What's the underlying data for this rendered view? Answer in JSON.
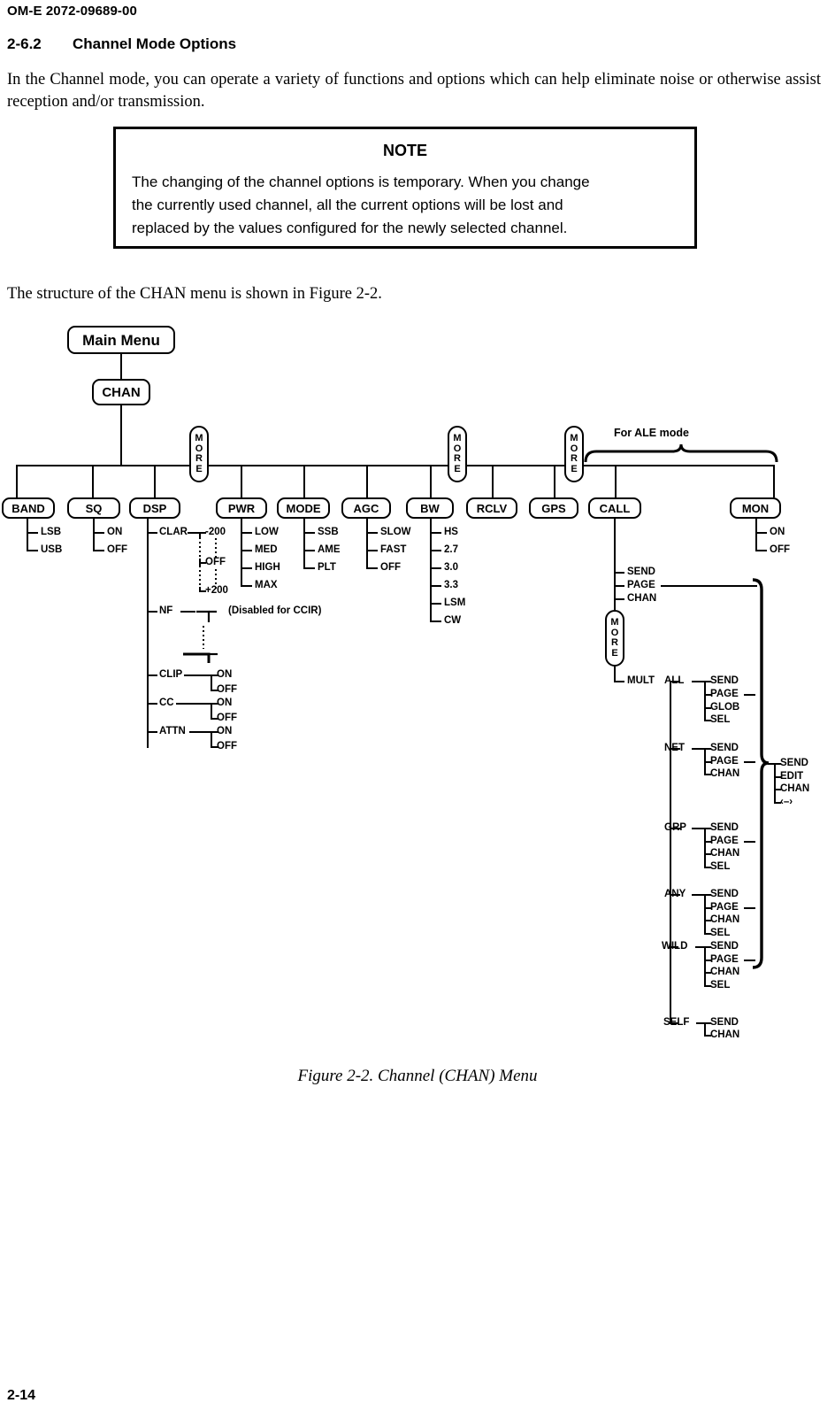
{
  "document": {
    "doc_id": "OM-E 2072-09689-00",
    "section_number": "2-6.2",
    "section_title": "Channel Mode Options",
    "body_paragraph": "In the Channel mode, you can operate a variety of functions and options which can help eliminate noise or otherwise assist reception and/or transmission.",
    "intro_paragraph": "The structure of the CHAN menu is shown in Figure 2-2.",
    "figure_caption": "Figure 2-2. Channel (CHAN) Menu",
    "page_number": "2-14"
  },
  "note": {
    "title": "NOTE",
    "line1": "The changing of the channel options is temporary. When you change",
    "line2": "the currently used channel, all the current options will be lost and",
    "line3": "replaced by the values configured for the newly selected channel."
  },
  "diagram": {
    "root": "Main Menu",
    "level1": "CHAN",
    "more_label": "MORE",
    "ale_bracket_label": "For ALE mode",
    "ccir_note": "(Disabled for CCIR)",
    "menu_items": [
      "BAND",
      "SQ",
      "DSP",
      "PWR",
      "MODE",
      "AGC",
      "BW",
      "RCLV",
      "GPS",
      "CALL",
      "MON"
    ],
    "band": {
      "options": [
        "LSB",
        "USB"
      ]
    },
    "sq": {
      "options": [
        "ON",
        "OFF"
      ]
    },
    "dsp": {
      "options": [
        "CLAR",
        "NF",
        "CLIP",
        "CC",
        "ATTN"
      ],
      "clar": {
        "min": "-200",
        "mid": "OFF",
        "max": "+200"
      },
      "clip": [
        "ON",
        "OFF"
      ],
      "cc": [
        "ON",
        "OFF"
      ],
      "attn": [
        "ON",
        "OFF"
      ]
    },
    "pwr": {
      "options": [
        "LOW",
        "MED",
        "HIGH",
        "MAX"
      ]
    },
    "mode": {
      "options": [
        "SSB",
        "AME",
        "PLT"
      ]
    },
    "agc": {
      "options": [
        "SLOW",
        "FAST",
        "OFF"
      ]
    },
    "bw": {
      "options": [
        "HS",
        "2.7",
        "3.0",
        "3.3",
        "LSM",
        "CW"
      ]
    },
    "mon": {
      "options": [
        "ON",
        "OFF"
      ]
    },
    "call": {
      "options": [
        "SEND",
        "PAGE",
        "CHAN"
      ],
      "mult_label": "MULT",
      "mult_groups": [
        {
          "name": "ALL",
          "options": [
            "SEND",
            "PAGE",
            "GLOB",
            "SEL"
          ]
        },
        {
          "name": "NET",
          "options": [
            "SEND",
            "PAGE",
            "CHAN"
          ]
        },
        {
          "name": "GRP",
          "options": [
            "SEND",
            "PAGE",
            "CHAN",
            "SEL"
          ]
        },
        {
          "name": "ANY",
          "options": [
            "SEND",
            "PAGE",
            "CHAN",
            "SEL"
          ]
        },
        {
          "name": "WILD",
          "options": [
            "SEND",
            "PAGE",
            "CHAN",
            "SEL"
          ]
        },
        {
          "name": "SELF",
          "options": [
            "SEND",
            "CHAN"
          ]
        }
      ],
      "page_submenu": [
        "SEND",
        "EDIT",
        "CHAN",
        "‹–›"
      ]
    }
  }
}
